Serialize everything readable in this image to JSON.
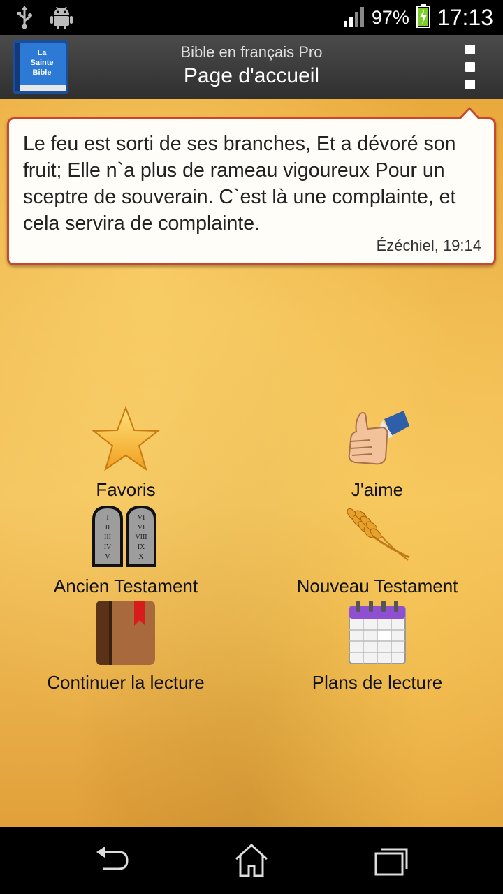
{
  "status_bar": {
    "battery_percent": "97%",
    "time": "17:13",
    "icons": [
      "usb-icon",
      "android-debug-icon",
      "signal-icon",
      "battery-charging-icon"
    ]
  },
  "action_bar": {
    "app_icon_text": [
      "La",
      "Sainte",
      "Bible"
    ],
    "subtitle": "Bible en français Pro",
    "title": "Page d'accueil"
  },
  "verse": {
    "text": "Le feu est sorti de ses branches, Et a dévoré son fruit; Elle n`a plus de rameau vigoureux Pour un sceptre de souverain. C`est là une complainte, et cela servira de complainte.",
    "reference": "Ézéchiel, 19:14"
  },
  "menu": {
    "items": [
      {
        "label": "Favoris",
        "icon": "star-icon"
      },
      {
        "label": "J'aime",
        "icon": "thumbs-up-icon"
      },
      {
        "label": "Ancien Testament",
        "icon": "stone-tablets-icon"
      },
      {
        "label": "Nouveau Testament",
        "icon": "wheat-icon"
      },
      {
        "label": "Continuer la lecture",
        "icon": "bookmark-book-icon"
      },
      {
        "label": "Plans de lecture",
        "icon": "calendar-icon"
      }
    ],
    "tablet_numerals_left": [
      "I",
      "II",
      "III",
      "IV",
      "V"
    ],
    "tablet_numerals_right": [
      "VI",
      "VI",
      "VIII",
      "IX",
      "X"
    ]
  },
  "colors": {
    "bubble_border": "#c9472e",
    "actionbar": "#3d3d3d",
    "parchment": "#f0bb52"
  }
}
